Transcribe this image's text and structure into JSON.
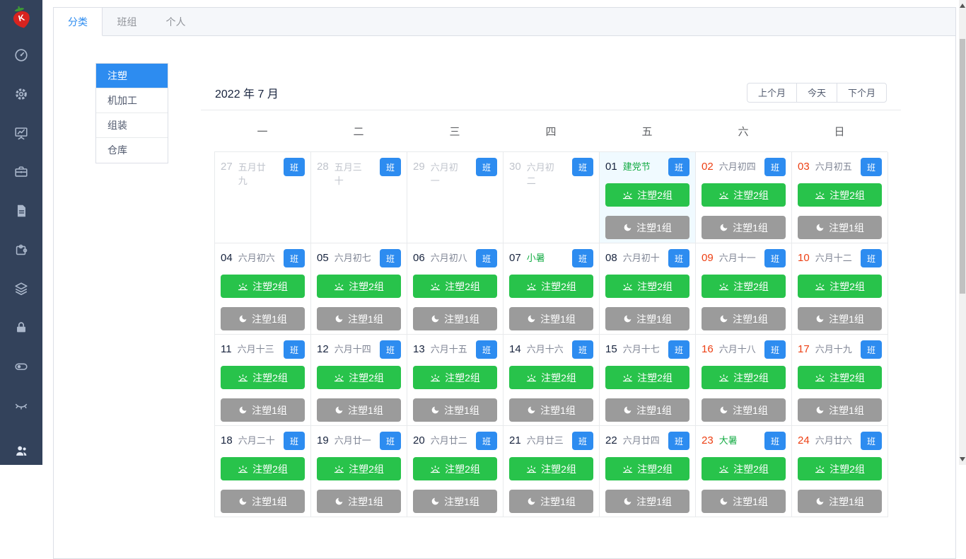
{
  "app": {
    "logo_letter": "K"
  },
  "tabs": {
    "items": [
      {
        "label": "分类",
        "active": true
      },
      {
        "label": "班组",
        "active": false
      },
      {
        "label": "个人",
        "active": false
      }
    ]
  },
  "category_menu": {
    "items": [
      {
        "label": "注塑",
        "active": true
      },
      {
        "label": "机加工",
        "active": false
      },
      {
        "label": "组装",
        "active": false
      },
      {
        "label": "仓库",
        "active": false
      }
    ]
  },
  "calendar": {
    "title": "2022 年 7 月",
    "nav": {
      "prev": "上个月",
      "today": "今天",
      "next": "下个月"
    },
    "weekdays": [
      "一",
      "二",
      "三",
      "四",
      "五",
      "六",
      "日"
    ],
    "badge_label": "班",
    "day_shift_label": "注塑2组",
    "night_shift_label": "注塑1组",
    "cells": [
      {
        "day": "27",
        "lunar": "五月廿九",
        "prev": true,
        "weekend": false,
        "holiday": false,
        "highlight": false,
        "shifts": false
      },
      {
        "day": "28",
        "lunar": "五月三十",
        "prev": true,
        "weekend": false,
        "holiday": false,
        "highlight": false,
        "shifts": false
      },
      {
        "day": "29",
        "lunar": "六月初一",
        "prev": true,
        "weekend": false,
        "holiday": false,
        "highlight": false,
        "shifts": false
      },
      {
        "day": "30",
        "lunar": "六月初二",
        "prev": true,
        "weekend": false,
        "holiday": false,
        "highlight": false,
        "shifts": false
      },
      {
        "day": "01",
        "lunar": "建党节",
        "prev": false,
        "weekend": false,
        "holiday": true,
        "highlight": true,
        "shifts": true
      },
      {
        "day": "02",
        "lunar": "六月初四",
        "prev": false,
        "weekend": true,
        "holiday": false,
        "highlight": false,
        "shifts": true
      },
      {
        "day": "03",
        "lunar": "六月初五",
        "prev": false,
        "weekend": true,
        "holiday": false,
        "highlight": false,
        "shifts": true
      },
      {
        "day": "04",
        "lunar": "六月初六",
        "prev": false,
        "weekend": false,
        "holiday": false,
        "highlight": false,
        "shifts": true
      },
      {
        "day": "05",
        "lunar": "六月初七",
        "prev": false,
        "weekend": false,
        "holiday": false,
        "highlight": false,
        "shifts": true
      },
      {
        "day": "06",
        "lunar": "六月初八",
        "prev": false,
        "weekend": false,
        "holiday": false,
        "highlight": false,
        "shifts": true
      },
      {
        "day": "07",
        "lunar": "小暑",
        "prev": false,
        "weekend": false,
        "holiday": true,
        "highlight": false,
        "shifts": true
      },
      {
        "day": "08",
        "lunar": "六月初十",
        "prev": false,
        "weekend": false,
        "holiday": false,
        "highlight": false,
        "shifts": true
      },
      {
        "day": "09",
        "lunar": "六月十一",
        "prev": false,
        "weekend": true,
        "holiday": false,
        "highlight": false,
        "shifts": true
      },
      {
        "day": "10",
        "lunar": "六月十二",
        "prev": false,
        "weekend": true,
        "holiday": false,
        "highlight": false,
        "shifts": true
      },
      {
        "day": "11",
        "lunar": "六月十三",
        "prev": false,
        "weekend": false,
        "holiday": false,
        "highlight": false,
        "shifts": true
      },
      {
        "day": "12",
        "lunar": "六月十四",
        "prev": false,
        "weekend": false,
        "holiday": false,
        "highlight": false,
        "shifts": true
      },
      {
        "day": "13",
        "lunar": "六月十五",
        "prev": false,
        "weekend": false,
        "holiday": false,
        "highlight": false,
        "shifts": true
      },
      {
        "day": "14",
        "lunar": "六月十六",
        "prev": false,
        "weekend": false,
        "holiday": false,
        "highlight": false,
        "shifts": true
      },
      {
        "day": "15",
        "lunar": "六月十七",
        "prev": false,
        "weekend": false,
        "holiday": false,
        "highlight": false,
        "shifts": true
      },
      {
        "day": "16",
        "lunar": "六月十八",
        "prev": false,
        "weekend": true,
        "holiday": false,
        "highlight": false,
        "shifts": true
      },
      {
        "day": "17",
        "lunar": "六月十九",
        "prev": false,
        "weekend": true,
        "holiday": false,
        "highlight": false,
        "shifts": true
      },
      {
        "day": "18",
        "lunar": "六月二十",
        "prev": false,
        "weekend": false,
        "holiday": false,
        "highlight": false,
        "shifts": true
      },
      {
        "day": "19",
        "lunar": "六月廿一",
        "prev": false,
        "weekend": false,
        "holiday": false,
        "highlight": false,
        "shifts": true
      },
      {
        "day": "20",
        "lunar": "六月廿二",
        "prev": false,
        "weekend": false,
        "holiday": false,
        "highlight": false,
        "shifts": true
      },
      {
        "day": "21",
        "lunar": "六月廿三",
        "prev": false,
        "weekend": false,
        "holiday": false,
        "highlight": false,
        "shifts": true
      },
      {
        "day": "22",
        "lunar": "六月廿四",
        "prev": false,
        "weekend": false,
        "holiday": false,
        "highlight": false,
        "shifts": true
      },
      {
        "day": "23",
        "lunar": "大暑",
        "prev": false,
        "weekend": true,
        "holiday": true,
        "highlight": false,
        "shifts": true
      },
      {
        "day": "24",
        "lunar": "六月廿六",
        "prev": false,
        "weekend": true,
        "holiday": false,
        "highlight": false,
        "shifts": true
      }
    ]
  },
  "colors": {
    "primary_blue": "#2d8cf0",
    "day_shift_green": "#28c34b",
    "night_shift_gray": "#9b9b9b",
    "weekend_red": "#ed4014",
    "holiday_green": "#13ab43",
    "sidebar_bg": "#33425b",
    "highlight_cell_bg": "#f0faff",
    "tabbar_bg": "#f5f7fa",
    "border_gray": "#dcdfe6"
  }
}
